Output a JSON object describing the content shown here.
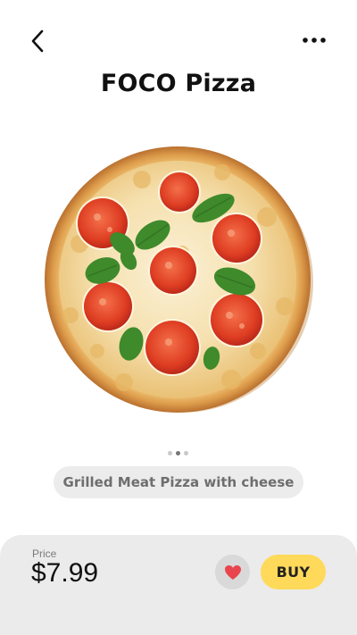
{
  "header": {
    "back_icon": "chevron-left-icon",
    "more_icon": "more-horizontal-icon",
    "title": "FOCO Pizza"
  },
  "product": {
    "image": "pizza-image",
    "carousel": {
      "count": 3,
      "active_index": 1
    },
    "subtitle": "Grilled Meat Pizza with cheese"
  },
  "purchase": {
    "price_label": "Price",
    "price": "$7.99",
    "favorite_icon": "heart-icon",
    "favorite_color": "#e8454f",
    "buy_label": "BUY",
    "buy_color": "#ffd95a"
  }
}
